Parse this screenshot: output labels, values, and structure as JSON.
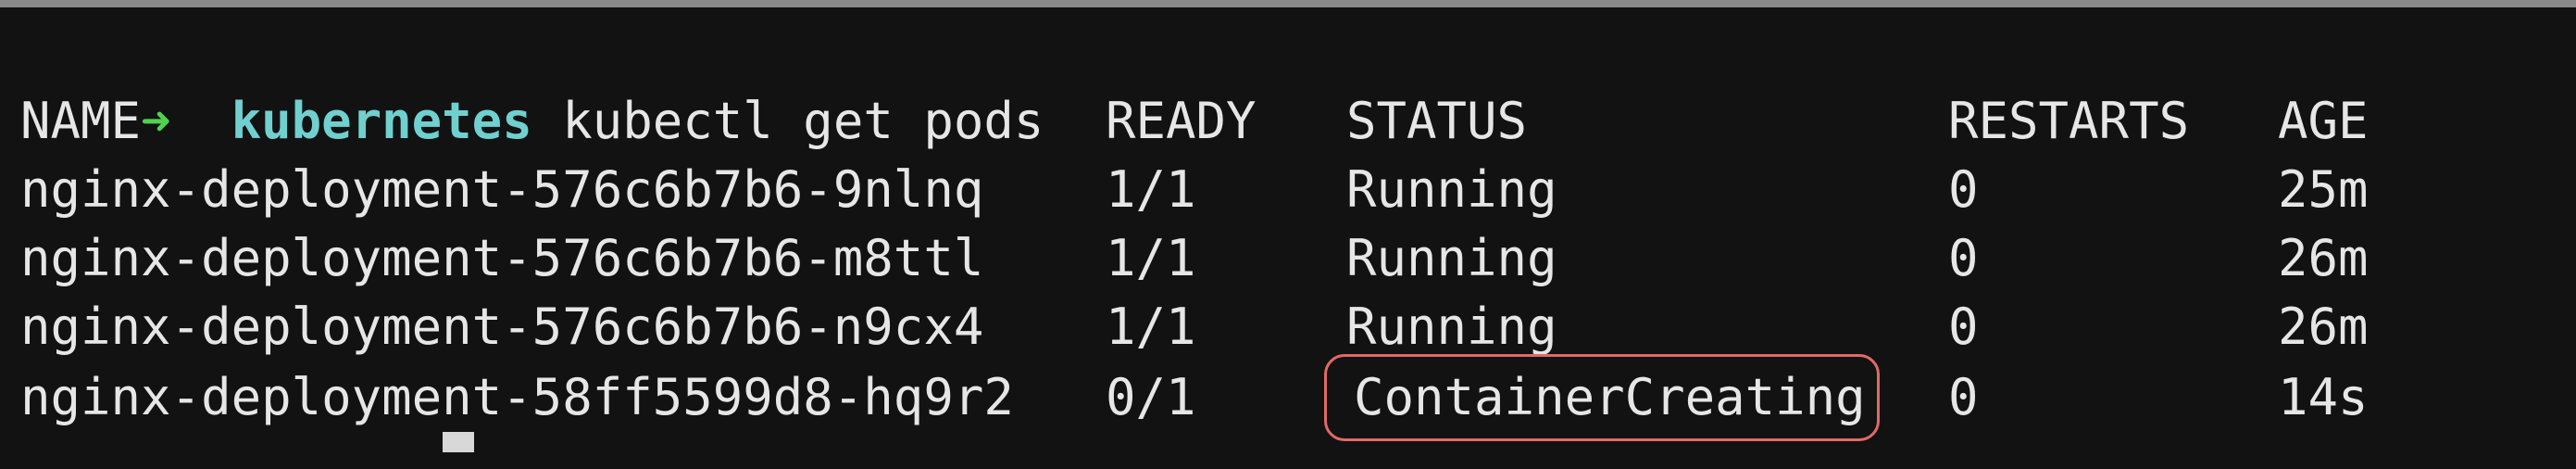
{
  "prompt": {
    "arrow": "➜",
    "directory": "kubernetes",
    "command": "kubectl get pods"
  },
  "table": {
    "headers": [
      "NAME",
      "READY",
      "STATUS",
      "RESTARTS",
      "AGE"
    ],
    "rows": [
      [
        "nginx-deployment-576c6b7b6-9nlnq",
        "1/1",
        "Running",
        "0",
        "25m"
      ],
      [
        "nginx-deployment-576c6b7b6-m8ttl",
        "1/1",
        "Running",
        "0",
        "26m"
      ],
      [
        "nginx-deployment-576c6b7b6-n9cx4",
        "1/1",
        "Running",
        "0",
        "26m"
      ],
      [
        "nginx-deployment-58ff5599d8-hq9r2",
        "0/1",
        "ContainerCreating",
        "0",
        "14s"
      ]
    ]
  },
  "colors": {
    "background": "#121212",
    "text": "#e6e6e6",
    "prompt_arrow": "#4fd34f",
    "prompt_directory": "#6fd0cf",
    "highlight": "#e06a66"
  }
}
